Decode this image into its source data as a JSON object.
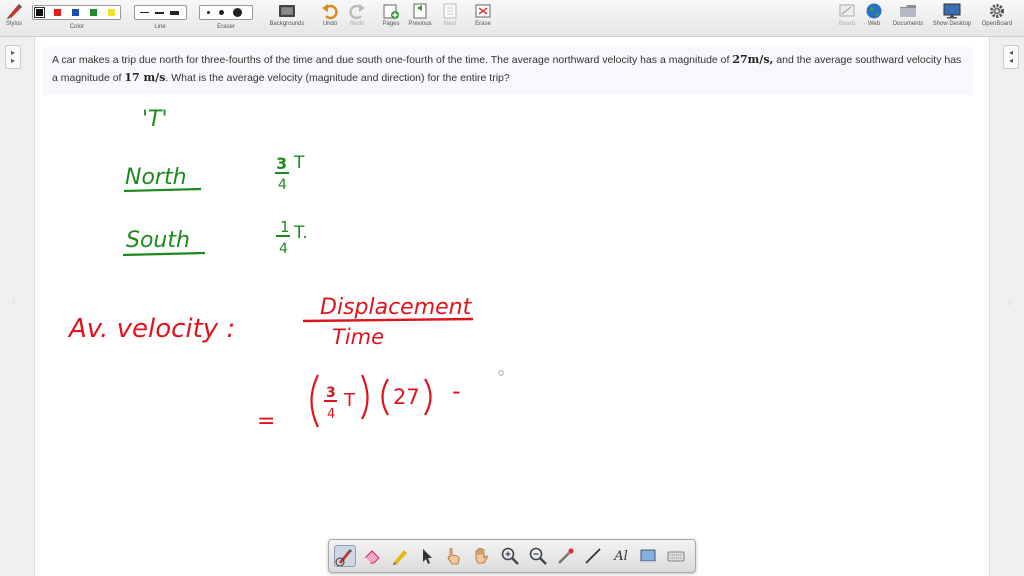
{
  "toolbar": {
    "stylus": "Stylus",
    "color": "Color",
    "line": "Line",
    "eraser": "Eraser",
    "backgrounds": "Backgrounds",
    "undo": "Undo",
    "redo": "Redo",
    "pages": "Pages",
    "previous": "Previous",
    "next": "Next",
    "erase": "Erase",
    "board": "Board",
    "web": "Web",
    "documents": "Documents",
    "show_desktop": "Show Desktop",
    "openboard": "OpenBoard",
    "colors": [
      "#111111",
      "#e02020",
      "#1a4fb5",
      "#1f8a2e",
      "#f2e32a"
    ],
    "selected_color": "#111111"
  },
  "question": {
    "text_1": "A car makes a trip due north for three-fourths of the time and due south one-fourth of the time. The average northward velocity has a magnitude of ",
    "north_speed": "27m/s,",
    "text_2": " and the average southward velocity has a magnitude of ",
    "south_speed": "17 m/s",
    "text_3": ". What is the average velocity (magnitude and direction) for the entire trip?"
  },
  "handwriting": {
    "t_label": "'T'",
    "north": "North",
    "north_frac_num": "3",
    "north_frac_den": "4",
    "north_t": "T",
    "south": "South",
    "south_frac_num": "1",
    "south_frac_den": "4",
    "south_t": "T.",
    "av_velocity": "Av. velocity :",
    "displacement": "Displacement",
    "time": "Time",
    "equals": "=",
    "expr_num": "3",
    "expr_den": "4",
    "expr_t": "T",
    "expr_27": "27",
    "expr_minus": "-",
    "green_ink": "#1e8a1e",
    "red_ink": "#e0141c"
  },
  "bottom_tools": {
    "text_tool": "Al"
  }
}
